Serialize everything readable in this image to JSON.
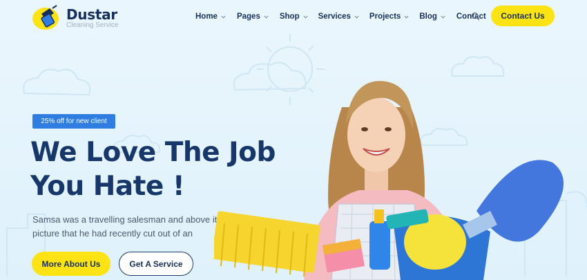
{
  "brand": {
    "name": "Dustar",
    "tagline": "Cleaning Service"
  },
  "nav": {
    "items": [
      {
        "label": "Home",
        "has_dropdown": true
      },
      {
        "label": "Pages",
        "has_dropdown": true
      },
      {
        "label": "Shop",
        "has_dropdown": true
      },
      {
        "label": "Services",
        "has_dropdown": true
      },
      {
        "label": "Projects",
        "has_dropdown": true
      },
      {
        "label": "Blog",
        "has_dropdown": true
      },
      {
        "label": "Contact",
        "has_dropdown": false
      }
    ],
    "search_icon": "search-icon",
    "cta_label": "Contact Us"
  },
  "hero": {
    "badge": "25% off for new client",
    "title_line1": "We Love The Job",
    "title_line2": "You Hate !",
    "description_line1": "Samsa was a travelling salesman and above it there hung a",
    "description_line2": "picture that he had recently cut out of an",
    "primary_button": "More About Us",
    "secondary_button": "Get A Service"
  },
  "colors": {
    "accent_yellow": "#fde314",
    "navy": "#17376b",
    "badge_blue": "#2f7de1",
    "background": "#e6f5fc"
  }
}
